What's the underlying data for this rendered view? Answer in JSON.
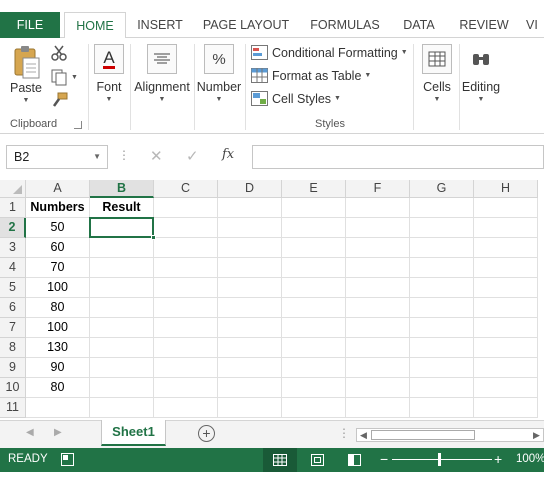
{
  "tabs": {
    "file": "FILE",
    "home": "HOME",
    "insert": "INSERT",
    "page_layout": "PAGE LAYOUT",
    "formulas": "FORMULAS",
    "data": "DATA",
    "review": "REVIEW",
    "view": "VI"
  },
  "ribbon": {
    "paste": "Paste",
    "clipboard": "Clipboard",
    "font": "Font",
    "alignment": "Alignment",
    "number": "Number",
    "number_icon": "%",
    "conditional_formatting": "Conditional Formatting",
    "format_as_table": "Format as Table",
    "cell_styles": "Cell Styles",
    "styles": "Styles",
    "cells": "Cells",
    "editing": "Editing"
  },
  "formula_bar": {
    "name_box": "B2",
    "fx": "fx",
    "value": ""
  },
  "columns": [
    "A",
    "B",
    "C",
    "D",
    "E",
    "F",
    "G",
    "H"
  ],
  "rows": [
    "1",
    "2",
    "3",
    "4",
    "5",
    "6",
    "7",
    "8",
    "9",
    "10",
    "11"
  ],
  "cells": {
    "A": [
      "Numbers",
      "50",
      "60",
      "70",
      "100",
      "80",
      "100",
      "130",
      "90",
      "80",
      ""
    ],
    "B": [
      "Result",
      "",
      "",
      "",
      "",
      "",
      "",
      "",
      "",
      "",
      ""
    ]
  },
  "selected_cell": "B2",
  "sheet": {
    "name": "Sheet1"
  },
  "status": {
    "ready": "READY",
    "zoom": "100%"
  },
  "colors": {
    "accent": "#217346"
  }
}
